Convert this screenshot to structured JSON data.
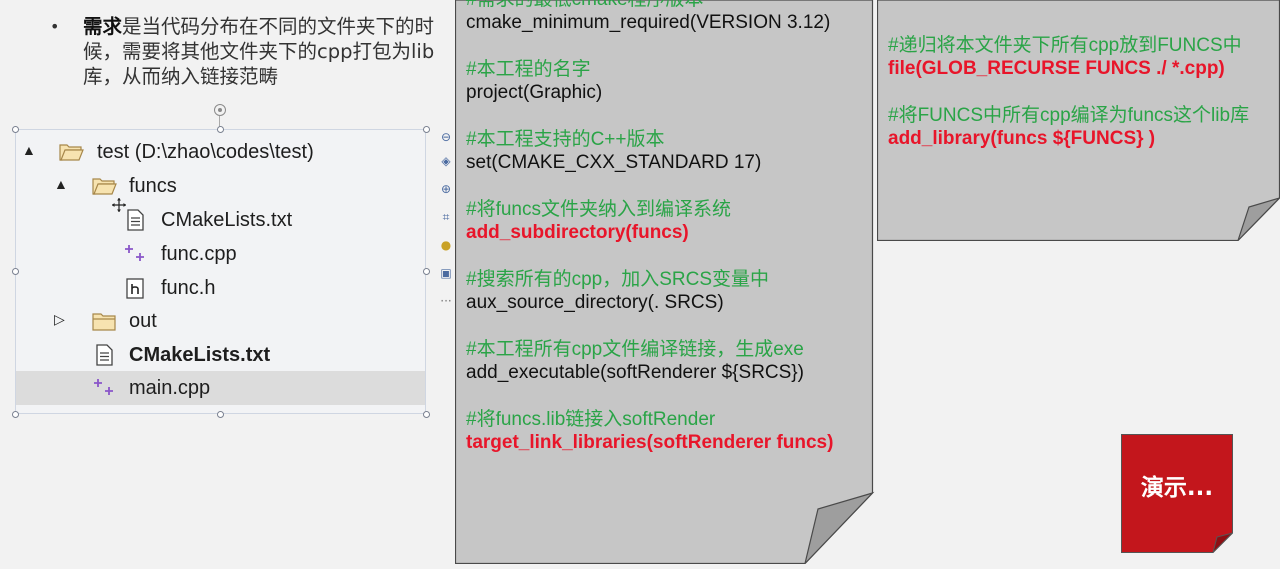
{
  "slide": {
    "bullet": {
      "bold_lead": "需求",
      "rest": "是当代码分布在不同的文件夹下的时候，需要将其他文件夹下的cpp打包为lib库，从而纳入链接范畴"
    }
  },
  "explorer": {
    "rows": [
      {
        "label": "test (D:\\zhao\\codes\\test)",
        "expand": "▲"
      },
      {
        "label": "funcs",
        "expand": "▲"
      },
      {
        "label": "CMakeLists.txt"
      },
      {
        "label": "func.cpp"
      },
      {
        "label": "func.h"
      },
      {
        "label": "out",
        "expand": "▷"
      },
      {
        "label": "CMakeLists.txt"
      },
      {
        "label": "main.cpp"
      }
    ],
    "selected_index": 7
  },
  "code_main": {
    "lines": [
      {
        "type": "cm",
        "text": "#需求的最低cmake程序版本"
      },
      {
        "type": "ln",
        "text": "cmake_minimum_required(VERSION 3.12)"
      },
      {
        "type": "cm",
        "text": "#本工程的名字"
      },
      {
        "type": "ln",
        "text": "project(Graphic)"
      },
      {
        "type": "cm",
        "text": "#本工程支持的C++版本"
      },
      {
        "type": "ln",
        "text": "set(CMAKE_CXX_STANDARD 17)"
      },
      {
        "type": "cm",
        "text": "#将funcs文件夹纳入到编译系统"
      },
      {
        "type": "em",
        "text": "add_subdirectory(funcs)"
      },
      {
        "type": "cm",
        "text": "#搜索所有的cpp，加入SRCS变量中"
      },
      {
        "type": "ln",
        "text": "aux_source_directory(. SRCS)"
      },
      {
        "type": "cm",
        "text": "#本工程所有cpp文件编译链接，生成exe"
      },
      {
        "type": "ln",
        "text": "add_executable(softRenderer ${SRCS})"
      },
      {
        "type": "cm",
        "text": "#将funcs.lib链接入softRender"
      },
      {
        "type": "em",
        "text": "target_link_libraries(softRenderer funcs)"
      }
    ]
  },
  "code_funcs": {
    "lines": [
      {
        "type": "cm",
        "text": "#递归将本文件夹下所有cpp放到FUNCS中"
      },
      {
        "type": "em",
        "text": "file(GLOB_RECURSE FUNCS ./  *.cpp)"
      },
      {
        "type": "cm",
        "text": "#将FUNCS中所有cpp编译为funcs这个lib库"
      },
      {
        "type": "em",
        "text": "add_library(funcs ${FUNCS} )"
      }
    ]
  },
  "demo_button": {
    "label": "演示..."
  },
  "colors": {
    "comment": "#2aa447",
    "keyword_red": "#e8152a",
    "note_fill": "#c6c6c6",
    "demo_fill": "#c3161c"
  }
}
